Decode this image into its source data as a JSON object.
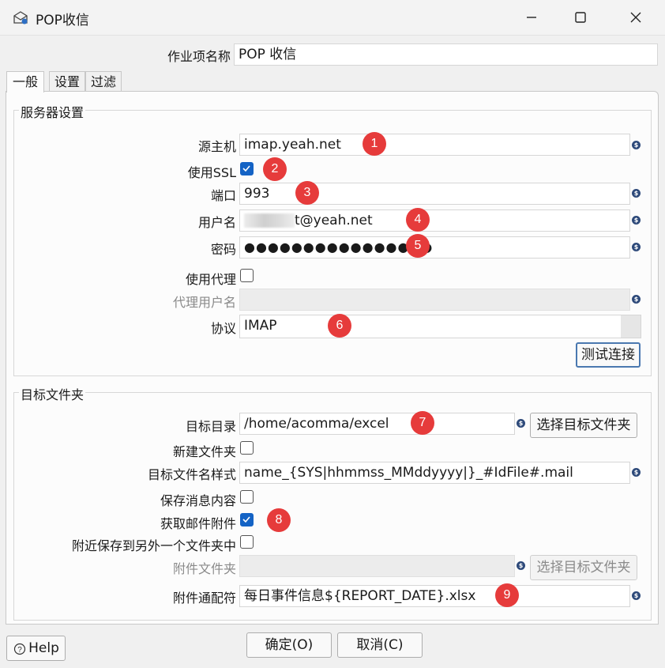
{
  "window": {
    "title": "POP收信",
    "icons": {
      "app": "mail-open-icon",
      "minimize": "minimize-icon",
      "maximize": "maximize-icon",
      "close": "close-icon"
    }
  },
  "job": {
    "name_label": "作业项名称",
    "name_value": "POP 收信"
  },
  "tabs": [
    {
      "label": "一般",
      "active": true
    },
    {
      "label": "设置",
      "active": false
    },
    {
      "label": "过滤",
      "active": false
    }
  ],
  "server": {
    "group_title": "服务器设置",
    "host_label": "源主机",
    "host_value": "imap.yeah.net",
    "ssl_label": "使用SSL",
    "ssl_checked": true,
    "port_label": "端口",
    "port_value": "993",
    "user_label": "用户名",
    "user_value": "t@yeah.net",
    "password_label": "密码",
    "password_value": "●●●●●●●●●●●●●●●●",
    "proxy_label": "使用代理",
    "proxy_checked": false,
    "proxy_user_label": "代理用户名",
    "proxy_user_value": "",
    "protocol_label": "协议",
    "protocol_value": "IMAP",
    "test_button": "测试连接"
  },
  "target": {
    "group_title": "目标文件夹",
    "dir_label": "目标目录",
    "dir_value": "/home/acomma/excel",
    "choose_button": "选择目标文件夹",
    "create_label": "新建文件夹",
    "create_checked": false,
    "pattern_label": "目标文件名样式",
    "pattern_value": "name_{SYS|hhmmss_MMddyyyy|}_#IdFile#.mail",
    "save_msg_label": "保存消息内容",
    "save_msg_checked": false,
    "get_attach_label": "获取邮件附件",
    "get_attach_checked": true,
    "attach_other_label": "附近保存到另外一个文件夹中",
    "attach_other_checked": false,
    "attach_dir_label": "附件文件夹",
    "attach_dir_value": "",
    "attach_choose_button": "选择目标文件夹",
    "wildcard_label": "附件通配符",
    "wildcard_value": "每日事件信息${REPORT_DATE}.xlsx"
  },
  "badges": [
    "1",
    "2",
    "3",
    "4",
    "5",
    "6",
    "7",
    "8",
    "9"
  ],
  "footer": {
    "help": "Help",
    "ok": "确定(O)",
    "cancel": "取消(C)"
  },
  "colors": {
    "badge": "#e63b3b",
    "checkbox": "#1463c5",
    "variable_icon": "#2e4a7a"
  }
}
